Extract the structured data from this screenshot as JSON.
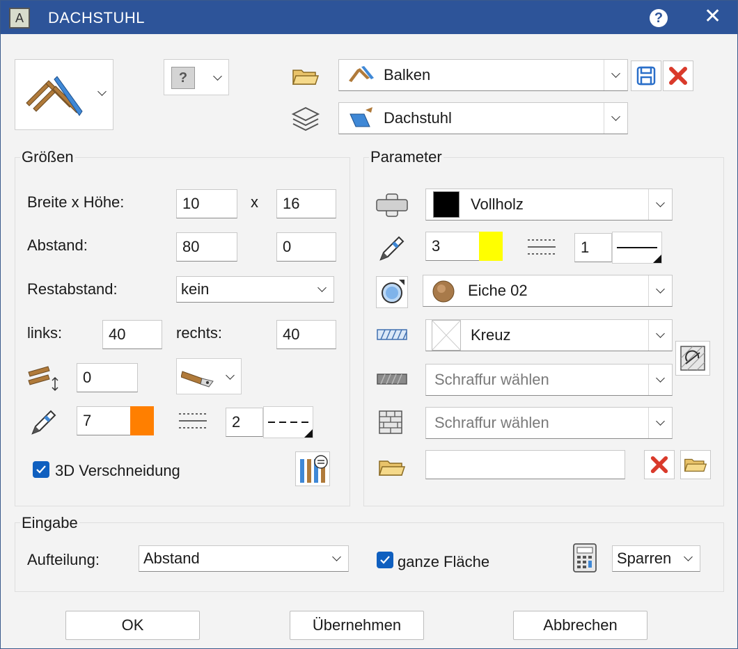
{
  "window": {
    "title": "DACHSTUHL",
    "help": "?",
    "close": "✕",
    "app_icon": "A"
  },
  "header": {
    "favorite_name": "Balken",
    "layer_name": "Dachstuhl",
    "info_glyph": "?"
  },
  "groessen": {
    "title": "Größen",
    "breite_hoehe_label": "Breite x Höhe:",
    "breite": "10",
    "x_label": "x",
    "hoehe": "16",
    "abstand_label": "Abstand:",
    "abstand_1": "80",
    "abstand_2": "0",
    "restabstand_label": "Restabstand:",
    "restabstand_value": "kein",
    "links_label": "links:",
    "links_value": "40",
    "rechts_label": "rechts:",
    "rechts_value": "40",
    "offset_value": "0",
    "pen_value": "7",
    "pen_color": "#ff7f00",
    "line_value": "2",
    "verschneidung_label": "3D Verschneidung",
    "verschneidung_checked": true
  },
  "parameter": {
    "title": "Parameter",
    "material_name": "Vollholz",
    "material_color": "#000000",
    "pen_value": "3",
    "pen_color": "#ffff00",
    "line_value": "1",
    "surface_name": "Eiche 02",
    "hatch_name": "Kreuz",
    "hatch2_placeholder": "Schraffur wählen",
    "hatch3_placeholder": "Schraffur wählen",
    "path_value": ""
  },
  "eingabe": {
    "title": "Eingabe",
    "aufteilung_label": "Aufteilung:",
    "aufteilung_value": "Abstand",
    "ganze_flaeche_label": "ganze Fläche",
    "ganze_flaeche_checked": true,
    "sparren_value": "Sparren"
  },
  "buttons": {
    "ok": "OK",
    "apply": "Übernehmen",
    "cancel": "Abbrechen"
  },
  "colors": {
    "title_bar": "#2d5499",
    "accent": "#0f5fbf",
    "delete_red": "#d93a2b"
  }
}
